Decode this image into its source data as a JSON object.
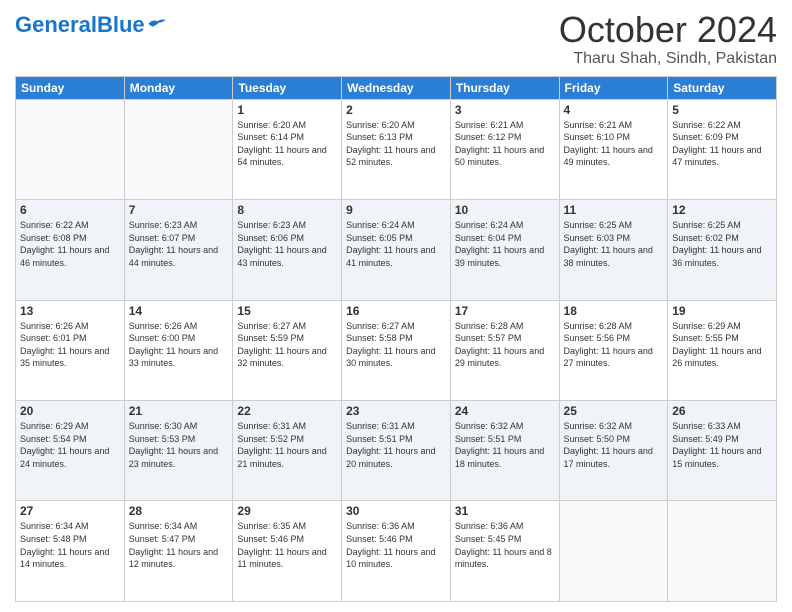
{
  "header": {
    "logo_text_general": "General",
    "logo_text_blue": "Blue",
    "month": "October 2024",
    "location": "Tharu Shah, Sindh, Pakistan"
  },
  "weekdays": [
    "Sunday",
    "Monday",
    "Tuesday",
    "Wednesday",
    "Thursday",
    "Friday",
    "Saturday"
  ],
  "weeks": [
    [
      {
        "day": "",
        "sunrise": "",
        "sunset": "",
        "daylight": ""
      },
      {
        "day": "",
        "sunrise": "",
        "sunset": "",
        "daylight": ""
      },
      {
        "day": "1",
        "sunrise": "Sunrise: 6:20 AM",
        "sunset": "Sunset: 6:14 PM",
        "daylight": "Daylight: 11 hours and 54 minutes."
      },
      {
        "day": "2",
        "sunrise": "Sunrise: 6:20 AM",
        "sunset": "Sunset: 6:13 PM",
        "daylight": "Daylight: 11 hours and 52 minutes."
      },
      {
        "day": "3",
        "sunrise": "Sunrise: 6:21 AM",
        "sunset": "Sunset: 6:12 PM",
        "daylight": "Daylight: 11 hours and 50 minutes."
      },
      {
        "day": "4",
        "sunrise": "Sunrise: 6:21 AM",
        "sunset": "Sunset: 6:10 PM",
        "daylight": "Daylight: 11 hours and 49 minutes."
      },
      {
        "day": "5",
        "sunrise": "Sunrise: 6:22 AM",
        "sunset": "Sunset: 6:09 PM",
        "daylight": "Daylight: 11 hours and 47 minutes."
      }
    ],
    [
      {
        "day": "6",
        "sunrise": "Sunrise: 6:22 AM",
        "sunset": "Sunset: 6:08 PM",
        "daylight": "Daylight: 11 hours and 46 minutes."
      },
      {
        "day": "7",
        "sunrise": "Sunrise: 6:23 AM",
        "sunset": "Sunset: 6:07 PM",
        "daylight": "Daylight: 11 hours and 44 minutes."
      },
      {
        "day": "8",
        "sunrise": "Sunrise: 6:23 AM",
        "sunset": "Sunset: 6:06 PM",
        "daylight": "Daylight: 11 hours and 43 minutes."
      },
      {
        "day": "9",
        "sunrise": "Sunrise: 6:24 AM",
        "sunset": "Sunset: 6:05 PM",
        "daylight": "Daylight: 11 hours and 41 minutes."
      },
      {
        "day": "10",
        "sunrise": "Sunrise: 6:24 AM",
        "sunset": "Sunset: 6:04 PM",
        "daylight": "Daylight: 11 hours and 39 minutes."
      },
      {
        "day": "11",
        "sunrise": "Sunrise: 6:25 AM",
        "sunset": "Sunset: 6:03 PM",
        "daylight": "Daylight: 11 hours and 38 minutes."
      },
      {
        "day": "12",
        "sunrise": "Sunrise: 6:25 AM",
        "sunset": "Sunset: 6:02 PM",
        "daylight": "Daylight: 11 hours and 36 minutes."
      }
    ],
    [
      {
        "day": "13",
        "sunrise": "Sunrise: 6:26 AM",
        "sunset": "Sunset: 6:01 PM",
        "daylight": "Daylight: 11 hours and 35 minutes."
      },
      {
        "day": "14",
        "sunrise": "Sunrise: 6:26 AM",
        "sunset": "Sunset: 6:00 PM",
        "daylight": "Daylight: 11 hours and 33 minutes."
      },
      {
        "day": "15",
        "sunrise": "Sunrise: 6:27 AM",
        "sunset": "Sunset: 5:59 PM",
        "daylight": "Daylight: 11 hours and 32 minutes."
      },
      {
        "day": "16",
        "sunrise": "Sunrise: 6:27 AM",
        "sunset": "Sunset: 5:58 PM",
        "daylight": "Daylight: 11 hours and 30 minutes."
      },
      {
        "day": "17",
        "sunrise": "Sunrise: 6:28 AM",
        "sunset": "Sunset: 5:57 PM",
        "daylight": "Daylight: 11 hours and 29 minutes."
      },
      {
        "day": "18",
        "sunrise": "Sunrise: 6:28 AM",
        "sunset": "Sunset: 5:56 PM",
        "daylight": "Daylight: 11 hours and 27 minutes."
      },
      {
        "day": "19",
        "sunrise": "Sunrise: 6:29 AM",
        "sunset": "Sunset: 5:55 PM",
        "daylight": "Daylight: 11 hours and 26 minutes."
      }
    ],
    [
      {
        "day": "20",
        "sunrise": "Sunrise: 6:29 AM",
        "sunset": "Sunset: 5:54 PM",
        "daylight": "Daylight: 11 hours and 24 minutes."
      },
      {
        "day": "21",
        "sunrise": "Sunrise: 6:30 AM",
        "sunset": "Sunset: 5:53 PM",
        "daylight": "Daylight: 11 hours and 23 minutes."
      },
      {
        "day": "22",
        "sunrise": "Sunrise: 6:31 AM",
        "sunset": "Sunset: 5:52 PM",
        "daylight": "Daylight: 11 hours and 21 minutes."
      },
      {
        "day": "23",
        "sunrise": "Sunrise: 6:31 AM",
        "sunset": "Sunset: 5:51 PM",
        "daylight": "Daylight: 11 hours and 20 minutes."
      },
      {
        "day": "24",
        "sunrise": "Sunrise: 6:32 AM",
        "sunset": "Sunset: 5:51 PM",
        "daylight": "Daylight: 11 hours and 18 minutes."
      },
      {
        "day": "25",
        "sunrise": "Sunrise: 6:32 AM",
        "sunset": "Sunset: 5:50 PM",
        "daylight": "Daylight: 11 hours and 17 minutes."
      },
      {
        "day": "26",
        "sunrise": "Sunrise: 6:33 AM",
        "sunset": "Sunset: 5:49 PM",
        "daylight": "Daylight: 11 hours and 15 minutes."
      }
    ],
    [
      {
        "day": "27",
        "sunrise": "Sunrise: 6:34 AM",
        "sunset": "Sunset: 5:48 PM",
        "daylight": "Daylight: 11 hours and 14 minutes."
      },
      {
        "day": "28",
        "sunrise": "Sunrise: 6:34 AM",
        "sunset": "Sunset: 5:47 PM",
        "daylight": "Daylight: 11 hours and 12 minutes."
      },
      {
        "day": "29",
        "sunrise": "Sunrise: 6:35 AM",
        "sunset": "Sunset: 5:46 PM",
        "daylight": "Daylight: 11 hours and 11 minutes."
      },
      {
        "day": "30",
        "sunrise": "Sunrise: 6:36 AM",
        "sunset": "Sunset: 5:46 PM",
        "daylight": "Daylight: 11 hours and 10 minutes."
      },
      {
        "day": "31",
        "sunrise": "Sunrise: 6:36 AM",
        "sunset": "Sunset: 5:45 PM",
        "daylight": "Daylight: 11 hours and 8 minutes."
      },
      {
        "day": "",
        "sunrise": "",
        "sunset": "",
        "daylight": ""
      },
      {
        "day": "",
        "sunrise": "",
        "sunset": "",
        "daylight": ""
      }
    ]
  ]
}
